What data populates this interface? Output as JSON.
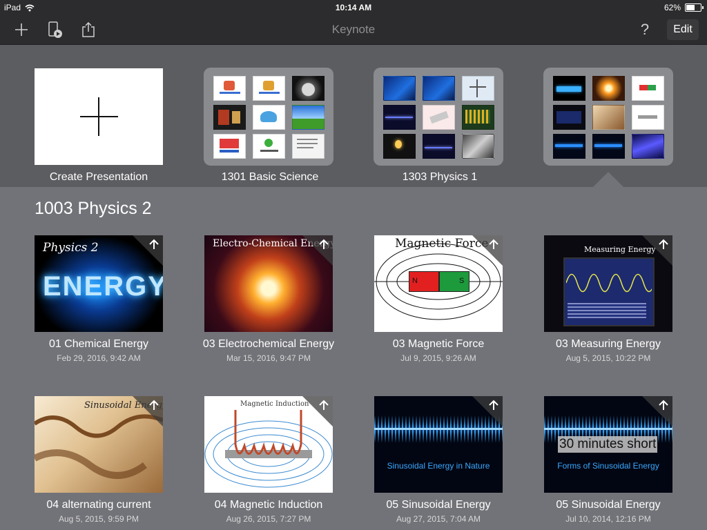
{
  "status": {
    "device": "iPad",
    "time": "10:14 AM",
    "battery": "62%",
    "battery_level": 0.62
  },
  "toolbar": {
    "title": "Keynote",
    "edit_label": "Edit",
    "help_label": "?"
  },
  "strip": {
    "create_label": "Create Presentation",
    "folders": [
      {
        "label": "1301 Basic Science"
      },
      {
        "label": "1303 Physics 1"
      },
      {
        "label": ""
      }
    ]
  },
  "section": {
    "title": "1003 Physics 2"
  },
  "docs": [
    {
      "name": "01 Chemical Energy",
      "date": "Feb 29, 2016, 9:42 AM",
      "thumb_title": "Physics 2",
      "thumb_sub": "ENERGY"
    },
    {
      "name": "03 Electrochemical Energy",
      "date": "Mar 15, 2016, 9:47 PM",
      "thumb_title": "Electro-Chemical Energy"
    },
    {
      "name": "03 Magnetic Force",
      "date": "Jul 9, 2015, 9:26 AM",
      "thumb_title": "Magnetic Force",
      "pole_n": "N",
      "pole_s": "S"
    },
    {
      "name": "03 Measuring Energy",
      "date": "Aug 5, 2015, 10:22 PM",
      "thumb_title": "Measuring Energy"
    },
    {
      "name": "04 alternating current",
      "date": "Aug 5, 2015, 9:59 PM",
      "thumb_title": "Sinusoidal Energy"
    },
    {
      "name": "04 Magnetic Induction",
      "date": "Aug 26, 2015, 7:27 PM",
      "thumb_title": "Magnetic Induction"
    },
    {
      "name": "05 Sinusoidal Energy",
      "date": "Aug 27, 2015, 7:04 AM",
      "thumb_title": "Sinusoidal Energy in Nature"
    },
    {
      "name": "05 Sinusoidal Energy",
      "date": "Jul 10, 2014, 12:16 PM",
      "thumb_title": "30 minutes short",
      "thumb_sub": "Forms of Sinusoidal Energy"
    }
  ],
  "colors": {
    "accent": "#ffffff",
    "background": "#727378",
    "toolbar": "#2c2c2e"
  }
}
